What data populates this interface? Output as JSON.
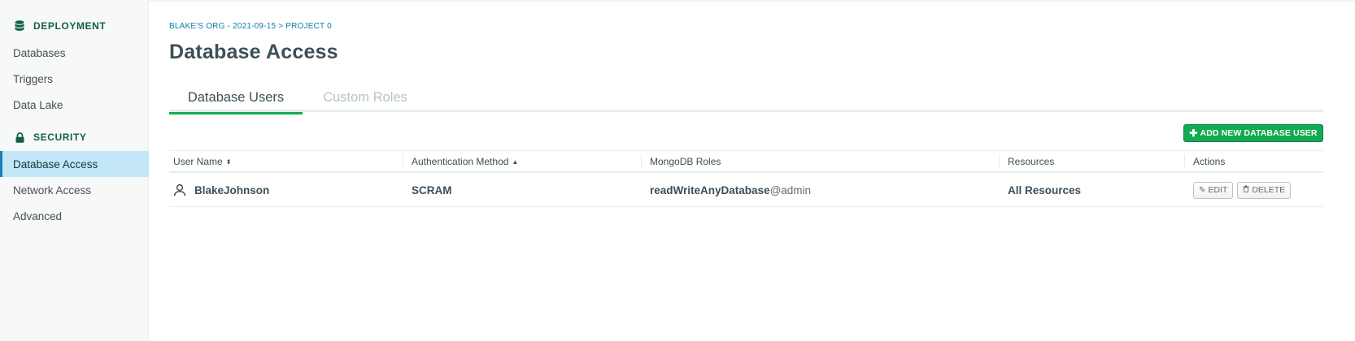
{
  "sidebar": {
    "deployment": {
      "label": "DEPLOYMENT",
      "icon": "database-icon"
    },
    "deployment_items": [
      "Databases",
      "Triggers",
      "Data Lake"
    ],
    "security": {
      "label": "SECURITY",
      "icon": "lock-icon"
    },
    "security_items": [
      "Database Access",
      "Network Access",
      "Advanced"
    ],
    "active_item": "Database Access"
  },
  "breadcrumb": {
    "org": "BLAKE'S ORG - 2021-09-15",
    "separator": ">",
    "project": "PROJECT 0"
  },
  "page_title": "Database Access",
  "tabs": [
    {
      "label": "Database Users",
      "active": true
    },
    {
      "label": "Custom Roles",
      "active": false
    }
  ],
  "add_button": {
    "icon": "plus",
    "label": "ADD NEW DATABASE USER"
  },
  "table": {
    "columns": [
      "User Name",
      "Authentication Method",
      "MongoDB Roles",
      "Resources",
      "Actions"
    ],
    "sort_indicators": {
      "user_name": "⬍",
      "auth_method": "▲"
    },
    "rows": [
      {
        "user_icon": "user-icon",
        "user_name": "BlakeJohnson",
        "auth_method": "SCRAM",
        "role": "readWriteAnyDatabase",
        "role_db": "@admin",
        "resources": "All Resources",
        "edit_label": "EDIT",
        "delete_label": "DELETE"
      }
    ]
  },
  "colors": {
    "accent": "#13aa52",
    "active_bg": "#c3e7f7",
    "link": "#0e7ea9",
    "section": "#116149"
  }
}
